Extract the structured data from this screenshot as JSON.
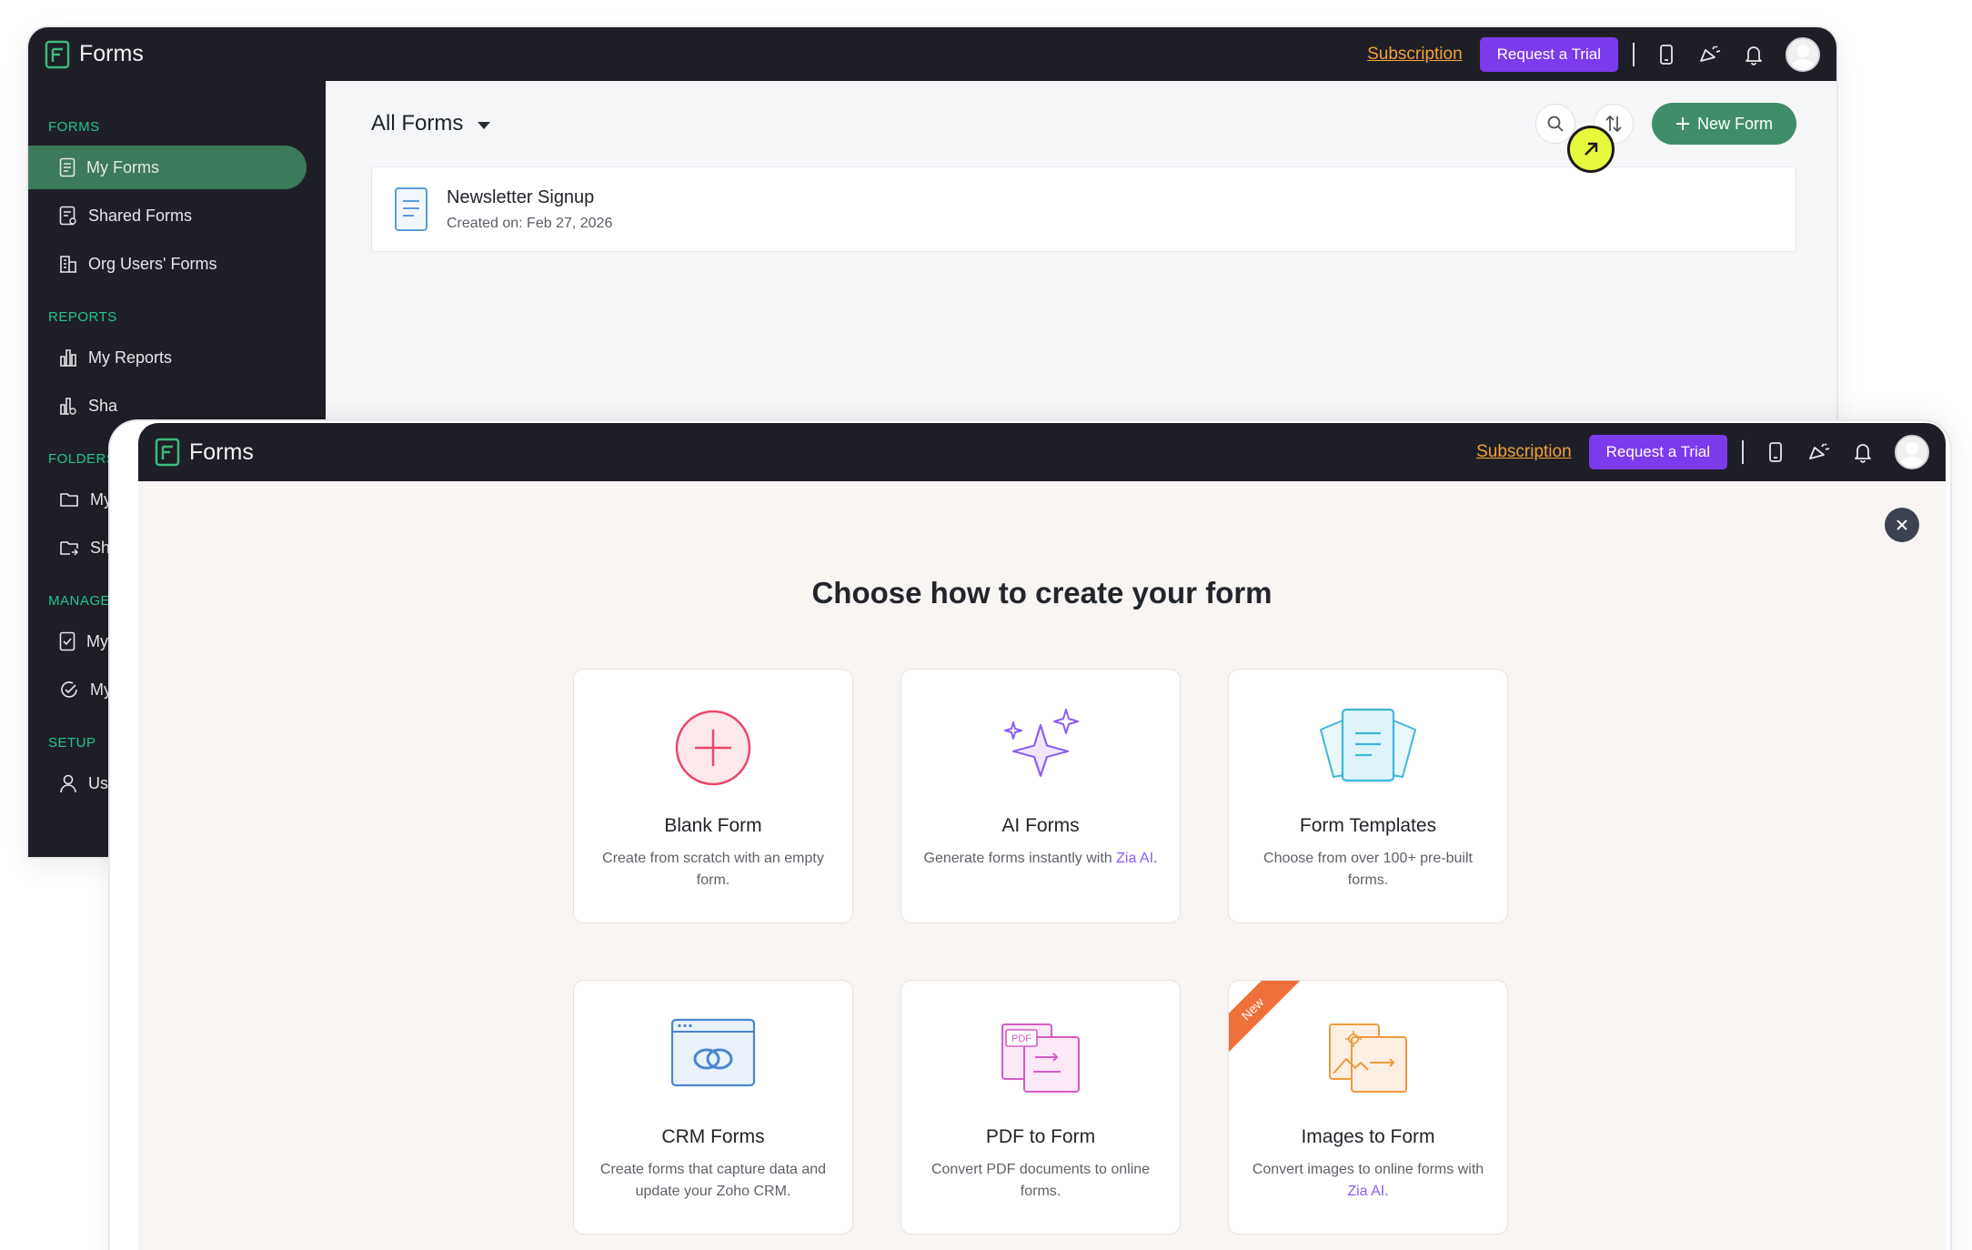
{
  "app": {
    "name": "Forms",
    "subscription_label": "Subscription",
    "trial_label": "Request a Trial"
  },
  "sidebar": {
    "sections": [
      {
        "heading": "FORMS",
        "items": [
          {
            "label": "My Forms",
            "icon": "form-icon",
            "active": true
          },
          {
            "label": "Shared Forms",
            "icon": "shared-form-icon"
          },
          {
            "label": "Org Users' Forms",
            "icon": "building-icon"
          }
        ]
      },
      {
        "heading": "REPORTS",
        "items": [
          {
            "label": "My Reports",
            "icon": "bar-chart-icon"
          },
          {
            "label": "Sha",
            "icon": "shared-report-icon"
          }
        ]
      },
      {
        "heading": "FOLDERS",
        "items": [
          {
            "label": "My",
            "icon": "folder-icon"
          },
          {
            "label": "Sh",
            "icon": "shared-folder-icon"
          }
        ]
      },
      {
        "heading": "MANAGE",
        "items": [
          {
            "label": "My",
            "icon": "approval-icon"
          },
          {
            "label": "My",
            "icon": "check-circle-icon"
          }
        ]
      },
      {
        "heading": "SETUP",
        "items": [
          {
            "label": "Us",
            "icon": "user-icon"
          }
        ]
      }
    ]
  },
  "main": {
    "view_title": "All Forms",
    "new_form_label": "New Form",
    "forms": [
      {
        "title": "Newsletter Signup",
        "created": "Created on: Feb 27, 2026"
      }
    ]
  },
  "modal": {
    "title": "Choose how to create your form",
    "cards": [
      {
        "title": "Blank Form",
        "desc": "Create from scratch with an empty form.",
        "icon": "plus-circle-icon"
      },
      {
        "title": "AI Forms",
        "desc": "Generate forms instantly with ",
        "link": "Zia AI",
        "suffix": ".",
        "icon": "sparkles-icon"
      },
      {
        "title": "Form Templates",
        "desc": "Choose from over 100+ pre-built forms.",
        "icon": "templates-icon"
      },
      {
        "title": "CRM Forms",
        "desc": "Create forms that capture data and update your Zoho CRM.",
        "icon": "crm-icon"
      },
      {
        "title": "PDF to Form",
        "desc": "Convert PDF documents to online forms.",
        "icon": "pdf-icon",
        "badge": "PDF"
      },
      {
        "title": "Images to Form",
        "desc": "Convert images to online forms with ",
        "link": "Zia AI",
        "suffix": ".",
        "icon": "image-icon",
        "ribbon": "New"
      }
    ]
  },
  "colors": {
    "topbar": "#1e1f26",
    "accent_green": "#3f8e69",
    "trial_purple": "#7c3aed",
    "subscription_orange": "#f0a23b",
    "cursor_highlight": "#e6f93c"
  }
}
